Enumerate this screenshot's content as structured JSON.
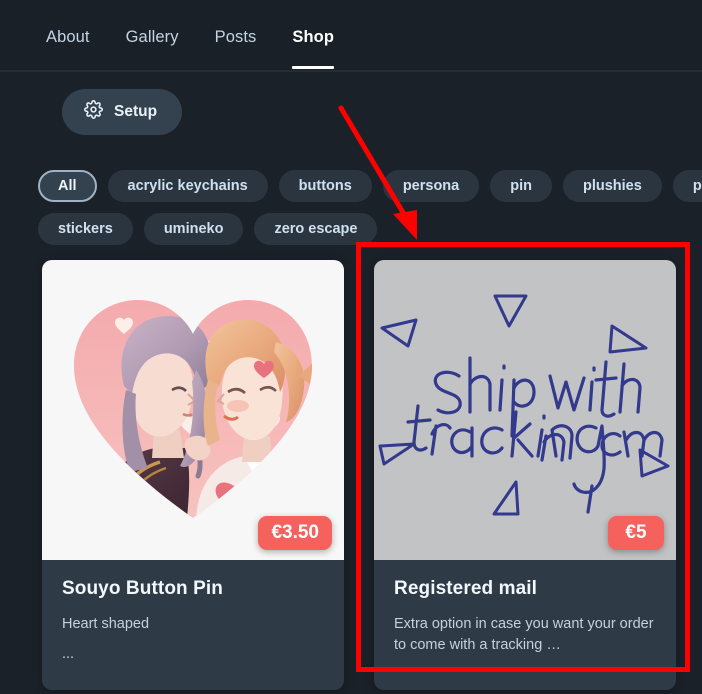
{
  "nav": {
    "items": [
      {
        "label": "About",
        "active": false
      },
      {
        "label": "Gallery",
        "active": false
      },
      {
        "label": "Posts",
        "active": false
      },
      {
        "label": "Shop",
        "active": true
      }
    ]
  },
  "toolbar": {
    "setup_label": "Setup",
    "setup_icon": "gear-icon"
  },
  "filters": {
    "row1": [
      {
        "label": "All",
        "selected": true
      },
      {
        "label": "acrylic keychains",
        "selected": false
      },
      {
        "label": "buttons",
        "selected": false
      },
      {
        "label": "persona",
        "selected": false
      },
      {
        "label": "pin",
        "selected": false
      },
      {
        "label": "plushies",
        "selected": false
      },
      {
        "label": "preorder",
        "selected": false
      }
    ],
    "row2": [
      {
        "label": "stickers",
        "selected": false
      },
      {
        "label": "umineko",
        "selected": false
      },
      {
        "label": "zero escape",
        "selected": false
      }
    ]
  },
  "products": [
    {
      "title": "Souyo Button Pin",
      "description": "Heart shaped",
      "more": "...",
      "price": "€3.50",
      "media_kind": "heart-illustration",
      "media_alt": "heart shaped anime couple illustration"
    },
    {
      "title": "Registered mail",
      "description": "Extra option in case you want your order to come with a tracking …",
      "more": "",
      "price": "€5",
      "media_kind": "handwritten-note",
      "media_alt": "handwritten note",
      "note_line1": "Ship  with",
      "note_line2": "tracking number"
    }
  ],
  "annotations": {
    "highlight_color": "#ff0000",
    "arrow_name": "red-annotation-arrow",
    "box_name": "red-annotation-box",
    "target": "Registered mail"
  },
  "colors": {
    "page_bg": "#1b2129",
    "nav_bg": "#1a2028",
    "card_bg": "#2e3a46",
    "chip_bg": "#2b3540",
    "chip_selected_bg": "#34414e",
    "price_badge": "#f5625e",
    "ink": "#2f3a8a"
  }
}
